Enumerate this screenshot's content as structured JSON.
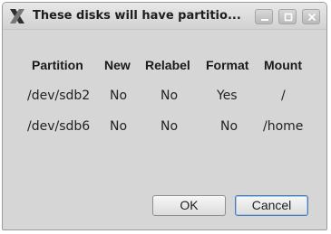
{
  "window": {
    "title": "These disks will have partitio..."
  },
  "table": {
    "headers": [
      "Partition",
      "New",
      "Relabel",
      "Format",
      "Mount"
    ],
    "rows": [
      [
        "/dev/sdb2",
        "No",
        "No",
        "Yes",
        "/"
      ],
      [
        "/dev/sdb6",
        "No",
        "No",
        "No",
        "/home"
      ]
    ]
  },
  "buttons": {
    "ok": "OK",
    "cancel": "Cancel"
  },
  "icons": {
    "app": "x-logo-icon",
    "minimize": "minimize-icon",
    "maximize": "maximize-icon",
    "close": "close-icon"
  },
  "colors": {
    "dialog_bg": "#d6d6d6",
    "default_button_border": "#4a7ab8"
  }
}
